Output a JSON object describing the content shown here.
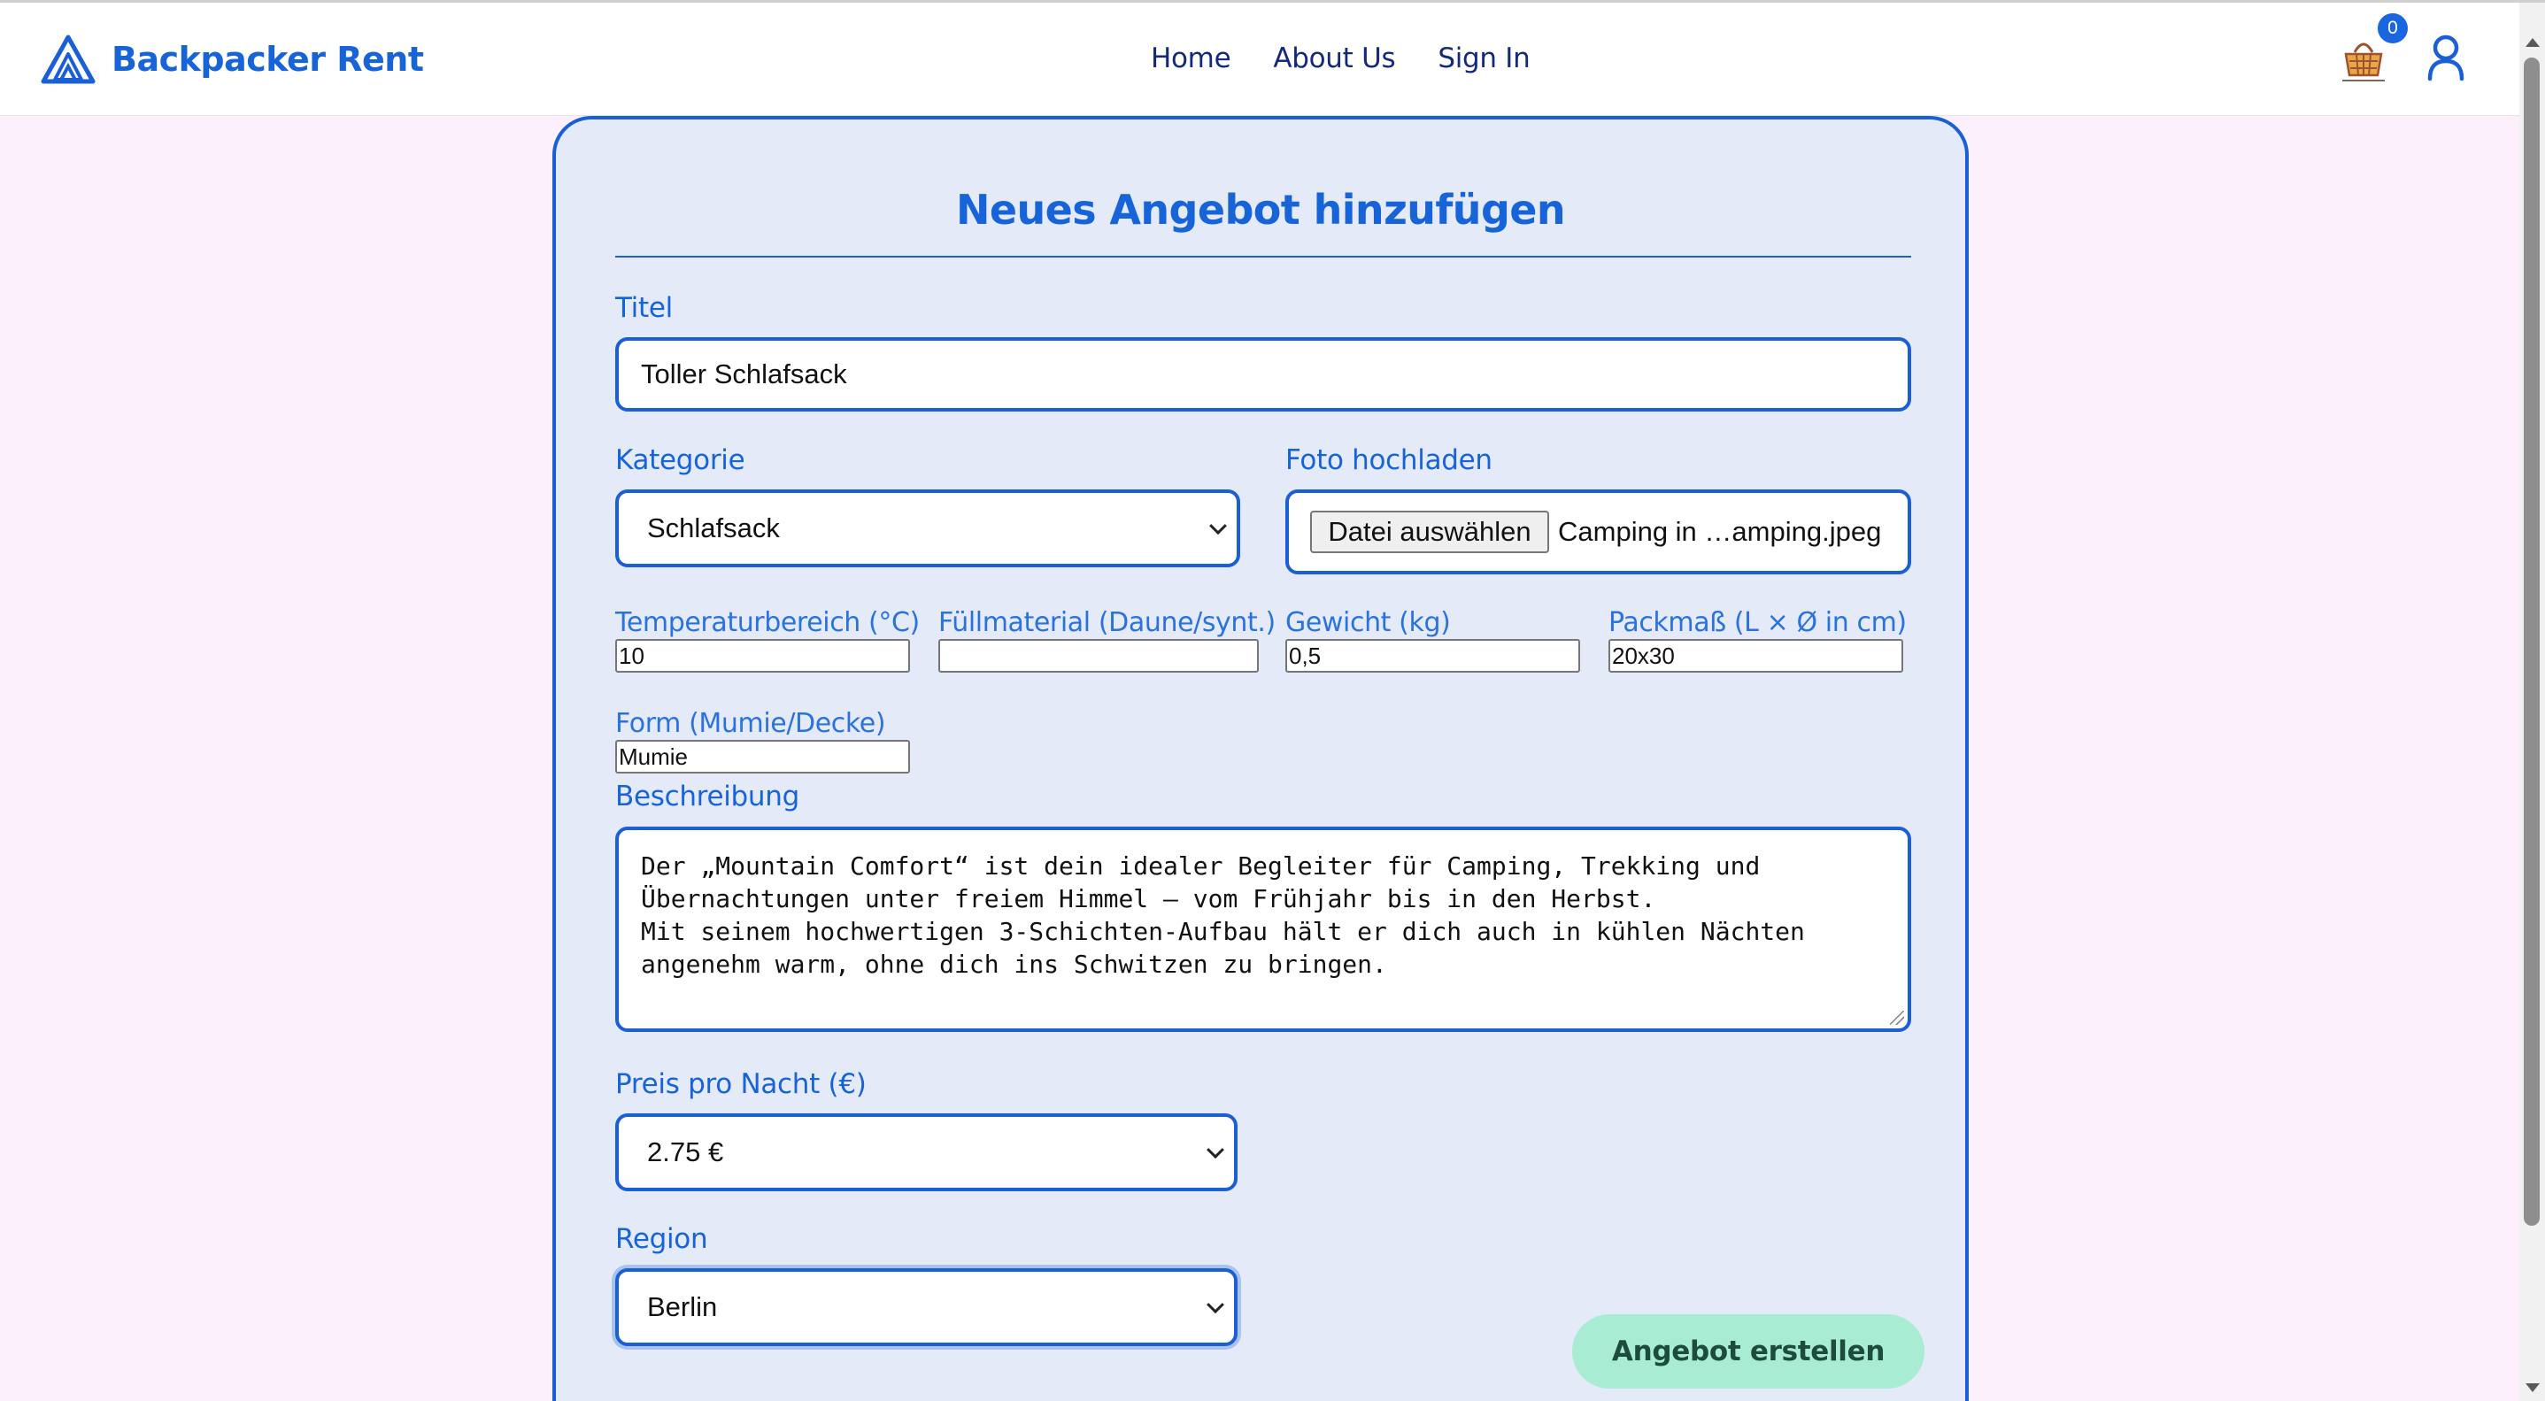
{
  "brand": {
    "name": "Backpacker Rent"
  },
  "nav": {
    "items": [
      "Home",
      "About Us",
      "Sign In"
    ]
  },
  "cart": {
    "count": "0"
  },
  "form": {
    "title": "Neues Angebot hinzufügen",
    "titel": {
      "label": "Titel",
      "value": "Toller Schlafsack"
    },
    "kategorie": {
      "label": "Kategorie",
      "value": "Schlafsack"
    },
    "foto": {
      "label": "Foto hochladen",
      "button": "Datei auswählen",
      "filename": "Camping in …amping.jpeg"
    },
    "specs": [
      {
        "label": "Temperaturbereich (°C)",
        "value": "10"
      },
      {
        "label": "Füllmaterial (Daune/synt.)",
        "value": ""
      },
      {
        "label": "Gewicht (kg)",
        "value": "0,5"
      },
      {
        "label": "Packmaß (L × Ø in cm)",
        "value": "20x30"
      },
      {
        "label": "Form (Mumie/Decke)",
        "value": "Mumie"
      }
    ],
    "beschreibung": {
      "label": "Beschreibung",
      "lines": [
        "Der „Mountain Comfort“ ist dein idealer Begleiter für Camping, Trekking und",
        "Übernachtungen unter freiem Himmel – vom Frühjahr bis in den Herbst.",
        "Mit seinem hochwertigen 3-Schichten-Aufbau hält er dich auch in kühlen Nächten",
        "angenehm warm, ohne dich ins Schwitzen zu bringen."
      ]
    },
    "preis": {
      "label": "Preis pro Nacht (€)",
      "value": "2.75 €"
    },
    "region": {
      "label": "Region",
      "value": "Berlin"
    },
    "submit": "Angebot erstellen"
  },
  "colors": {
    "primary": "#1a5fd6",
    "nav_text": "#14297a",
    "background": "#fcf0fc",
    "card": "#e4eaf8",
    "submit": "#a8ecd3"
  },
  "icons": {
    "logo": "mountain-logo-icon",
    "cart": "basket-icon",
    "user": "user-icon"
  }
}
